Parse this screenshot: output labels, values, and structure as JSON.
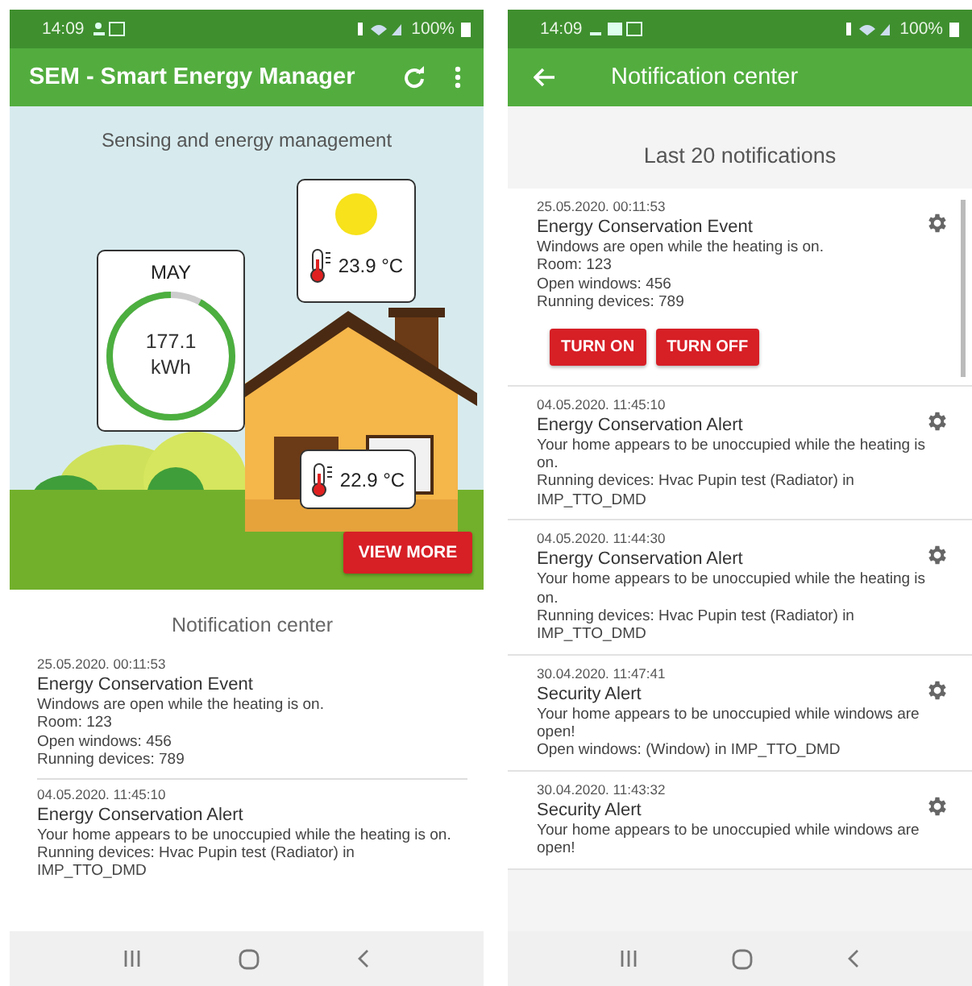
{
  "home_screen": {
    "status_bar": {
      "time": "14:09",
      "battery": "100%"
    },
    "app_bar": {
      "title": "SEM - Smart Energy Manager"
    },
    "hero": {
      "subtitle": "Sensing and energy management",
      "energy": {
        "month": "MAY",
        "value": "177.1",
        "unit": "kWh",
        "level": 0.92
      },
      "outdoor_temperature": "23.9 °C",
      "indoor_temperature": "22.9 °C",
      "button": "VIEW MORE"
    },
    "notifications": {
      "title": "Notification center",
      "items": [
        {
          "timestamp": "25.05.2020. 00:11:53",
          "title": "Energy Conservation Event",
          "lines": [
            "Windows are open while the heating is on.",
            "Room: 123",
            "Open windows: 456",
            "Running devices: 789"
          ]
        },
        {
          "timestamp": "04.05.2020. 11:45:10",
          "title": "Energy Conservation Alert",
          "lines": [
            "Your home appears to be unoccupied while the heating is on.",
            "Running devices: Hvac Pupin test (Radiator) in IMP_TTO_DMD"
          ]
        }
      ]
    }
  },
  "notification_screen": {
    "status_bar": {
      "time": "14:09",
      "battery": "100%"
    },
    "app_bar": {
      "title": "Notification center"
    },
    "heading": "Last 20 notifications",
    "items": [
      {
        "timestamp": "25.05.2020. 00:11:53",
        "title": "Energy Conservation Event",
        "lines": [
          "Windows are open while the heating is on.",
          "Room: 123",
          "Open windows: 456",
          "Running devices: 789"
        ],
        "actions": [
          "TURN ON",
          "TURN OFF"
        ]
      },
      {
        "timestamp": "04.05.2020. 11:45:10",
        "title": "Energy Conservation Alert",
        "lines": [
          "Your home appears to be unoccupied while the heating is on.",
          "Running devices: Hvac Pupin test (Radiator) in IMP_TTO_DMD"
        ]
      },
      {
        "timestamp": "04.05.2020. 11:44:30",
        "title": "Energy Conservation Alert",
        "lines": [
          "Your home appears to be unoccupied while the heating is on.",
          "Running devices: Hvac Pupin test (Radiator) in IMP_TTO_DMD"
        ]
      },
      {
        "timestamp": "30.04.2020. 11:47:41",
        "title": "Security Alert",
        "lines": [
          "Your home appears to be unoccupied while windows are open!",
          "Open windows:  (Window) in IMP_TTO_DMD"
        ]
      },
      {
        "timestamp": "30.04.2020. 11:43:32",
        "title": "Security Alert",
        "lines": [
          "Your home appears to be unoccupied while windows are open!"
        ]
      }
    ]
  }
}
